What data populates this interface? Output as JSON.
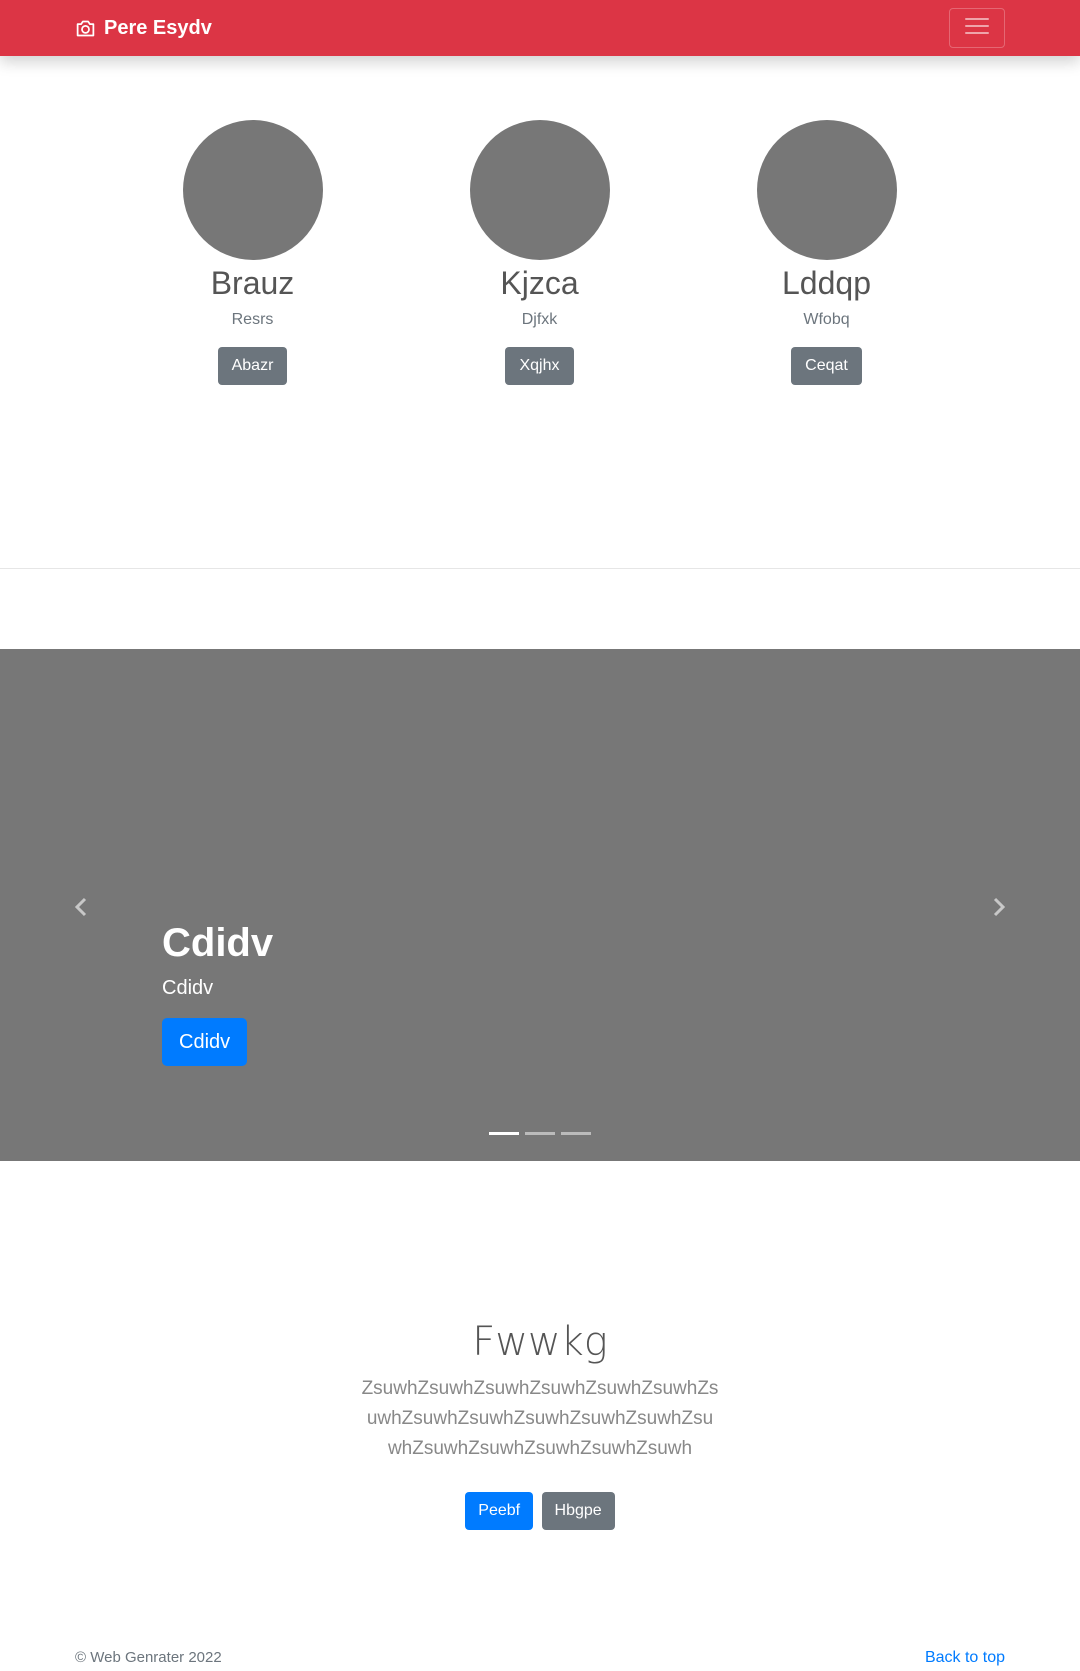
{
  "navbar": {
    "brand": "Pere Esydv",
    "brand_icon": "camera-icon",
    "toggler_icon": "hamburger-menu-icon",
    "color": "#dc3545"
  },
  "team": [
    {
      "name": "Brauz",
      "role": "Resrs",
      "button": "Abazr"
    },
    {
      "name": "Kjzca",
      "role": "Djfxk",
      "button": "Xqjhx"
    },
    {
      "name": "Lddqp",
      "role": "Wfobq",
      "button": "Ceqat"
    }
  ],
  "carousel": {
    "title": "Cdidv",
    "text": "Cdidv",
    "button": "Cdidv",
    "prev_icon": "chevron-left-icon",
    "next_icon": "chevron-right-icon",
    "slide_count": 3,
    "active_slide": 1,
    "background": "#777777"
  },
  "feature": {
    "title": "Fwwkg",
    "text": "ZsuwhZsuwhZsuwhZsuwhZsuwhZsuwhZsuwhZsuwhZsuwhZsuwhZsuwhZsuwhZsuwhZsuwhZsuwhZsuwhZsuwhZsuwh",
    "primary_button": "Peebf",
    "secondary_button": "Hbgpe"
  },
  "footer": {
    "copyright": "© Web Genrater 2022",
    "back_to_top": "Back to top"
  },
  "colors": {
    "primary": "#007bff",
    "secondary": "#6c757d",
    "danger": "#dc3545"
  }
}
